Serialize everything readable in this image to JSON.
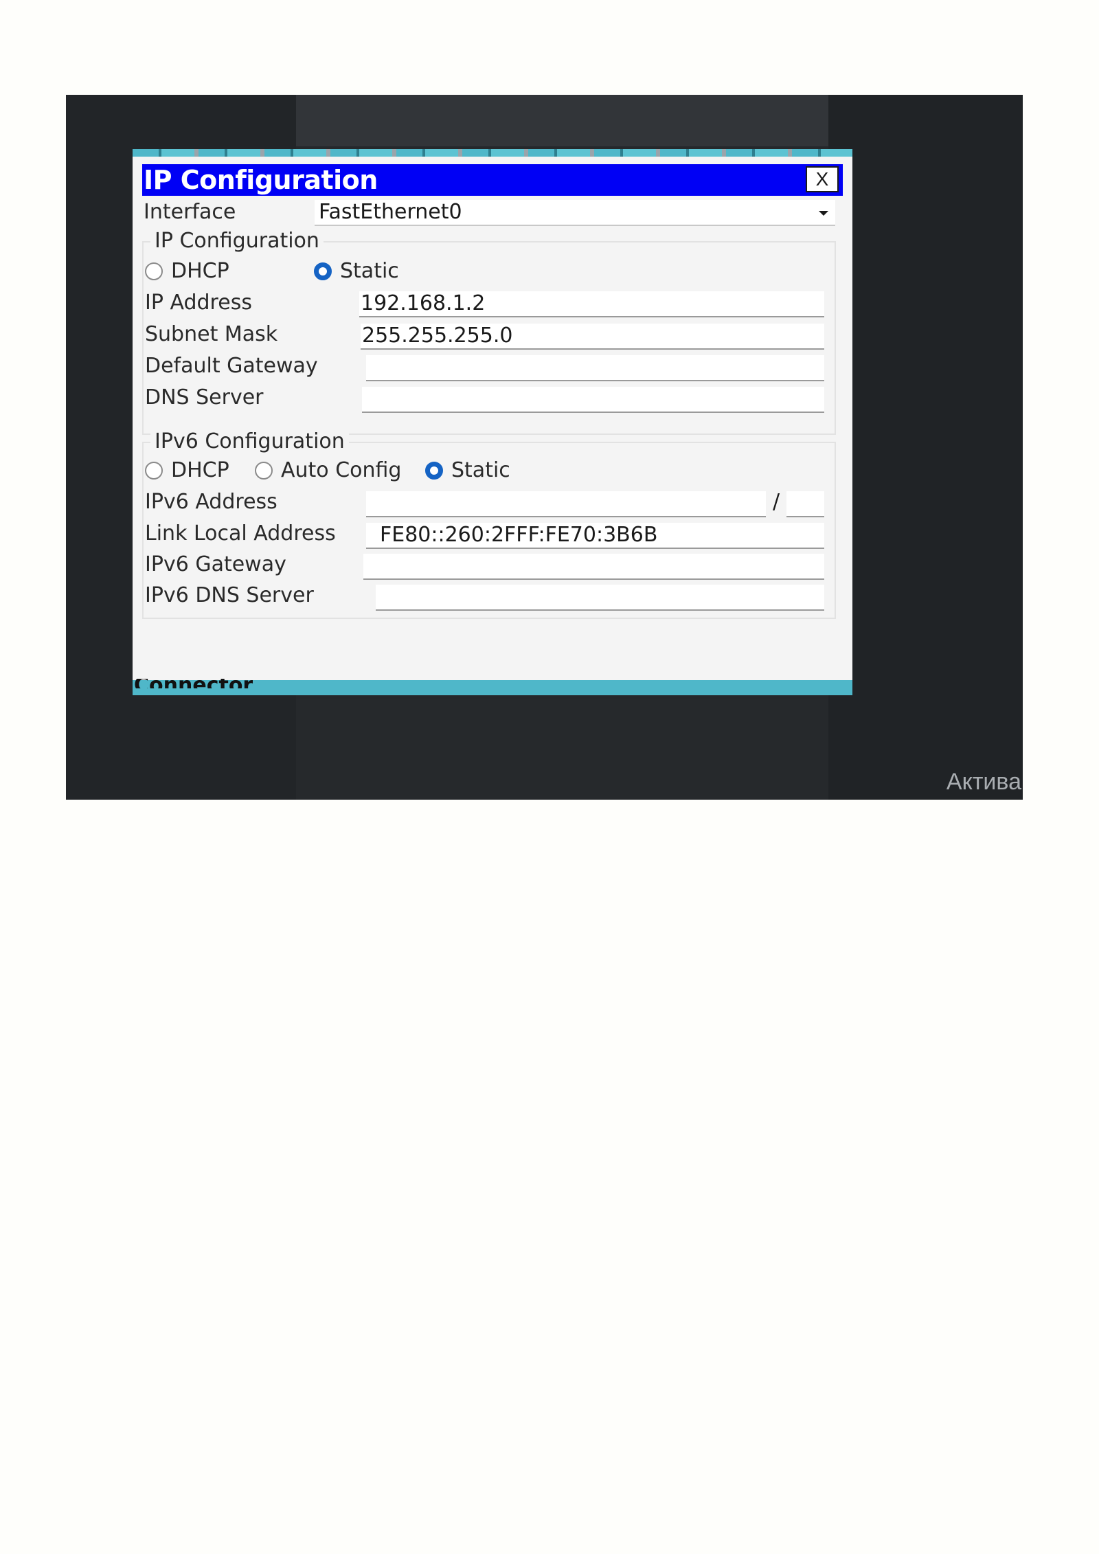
{
  "dialog": {
    "title": "IP Configuration",
    "close_label": "X",
    "interface_label": "Interface",
    "interface_value": "FastEthernet0"
  },
  "ipv4": {
    "group_label": "IP Configuration",
    "dhcp_label": "DHCP",
    "static_label": "Static",
    "selected_mode": "Static",
    "ip_address_label": "IP Address",
    "ip_address_value": "192.168.1.2",
    "subnet_mask_label": "Subnet Mask",
    "subnet_mask_value": "255.255.255.0",
    "default_gateway_label": "Default Gateway",
    "default_gateway_value": "",
    "dns_server_label": "DNS Server",
    "dns_server_value": ""
  },
  "ipv6": {
    "group_label": "IPv6 Configuration",
    "dhcp_label": "DHCP",
    "auto_config_label": "Auto Config",
    "static_label": "Static",
    "selected_mode": "Static",
    "address_label": "IPv6 Address",
    "address_value": "",
    "prefix_separator": "/",
    "prefix_value": "",
    "link_local_label": "Link Local Address",
    "link_local_value": "FE80::260:2FFF:FE70:3B6B",
    "gateway_label": "IPv6 Gateway",
    "gateway_value": "",
    "dns_server_label": "IPv6 DNS Server",
    "dns_server_value": ""
  },
  "background": {
    "partial_bottom_label": "Connector",
    "watermark": "Актива"
  },
  "colors": {
    "titlebar": "#0000f5",
    "radio_selected": "#1563c4",
    "accent_strip": "#4fb7c9"
  }
}
